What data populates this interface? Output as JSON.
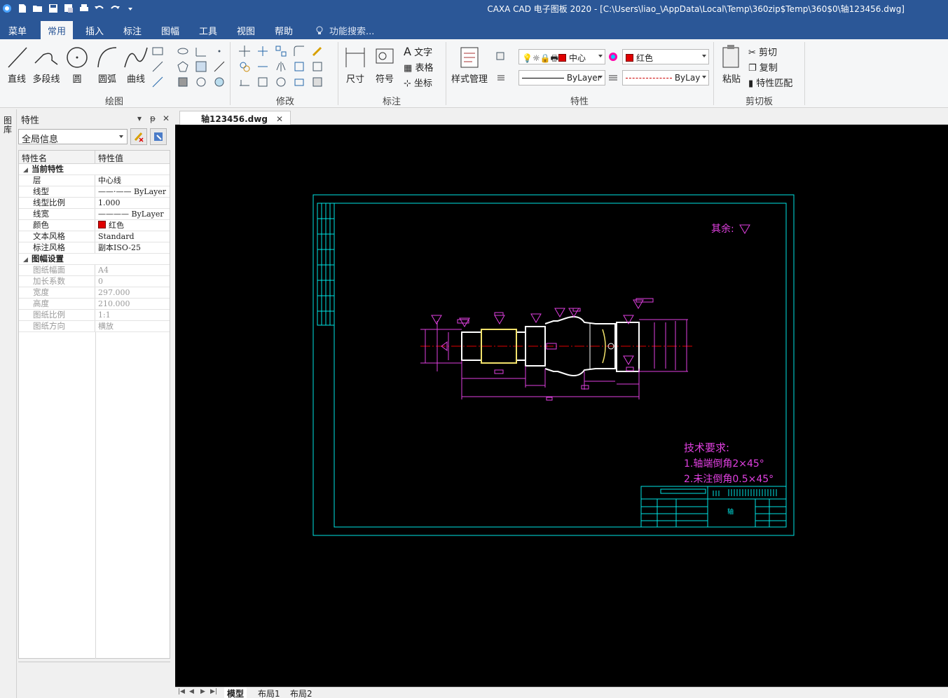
{
  "title": "CAXA CAD 电子图板 2020 - [C:\\Users\\liao_\\AppData\\Local\\Temp\\360zip$Temp\\360$0\\轴123456.dwg]",
  "menu": {
    "tabs": [
      "菜单",
      "常用",
      "插入",
      "标注",
      "图幅",
      "工具",
      "视图",
      "帮助"
    ],
    "active": "常用",
    "search_placeholder": "功能搜索..."
  },
  "ribbon": {
    "draw": {
      "label": "绘图",
      "line": "直线",
      "polyline": "多段线",
      "circle": "圆",
      "arc": "圆弧",
      "curve": "曲线"
    },
    "modify": {
      "label": "修改"
    },
    "annot": {
      "label": "标注",
      "dimension": "尺寸",
      "symbol": "符号",
      "text": "文字",
      "table": "表格",
      "coord": "坐标"
    },
    "style": {
      "label": "样式管理"
    },
    "properties": {
      "label": "特性",
      "layer": "中心",
      "color": "红色",
      "linetype": "ByLayer",
      "linewidth": "ByLay"
    },
    "clipboard": {
      "label": "剪切板",
      "paste": "粘贴",
      "cut": "剪切",
      "copy": "复制",
      "match": "特性匹配"
    }
  },
  "left_strip": {
    "label": "图库"
  },
  "props": {
    "title": "特性",
    "pin": "ᵽ",
    "filter": "全局信息",
    "col_name": "特性名",
    "col_value": "特性值",
    "cat1": "当前特性",
    "rows1": [
      {
        "k": "层",
        "v": "中心线"
      },
      {
        "k": "线型",
        "v": "——·—— ByLayer"
      },
      {
        "k": "线型比例",
        "v": "1.000"
      },
      {
        "k": "线宽",
        "v": "———— ByLayer"
      },
      {
        "k": "颜色",
        "v": "红色"
      },
      {
        "k": "文本风格",
        "v": "Standard"
      },
      {
        "k": "标注风格",
        "v": "副本ISO-25"
      }
    ],
    "cat2": "图幅设置",
    "rows2": [
      {
        "k": "图纸幅面",
        "v": "A4"
      },
      {
        "k": "加长系数",
        "v": "0"
      },
      {
        "k": "宽度",
        "v": "297.000"
      },
      {
        "k": "高度",
        "v": "210.000"
      },
      {
        "k": "图纸比例",
        "v": "1:1"
      },
      {
        "k": "图纸方向",
        "v": "横放"
      }
    ]
  },
  "doc_tab": "轴123456.dwg",
  "drawing": {
    "roughness_note": "其余:",
    "req_title": "技术要求:",
    "req_1": "1.轴端倒角2×45°",
    "req_2": "2.未注倒角0.5×45°",
    "title_block_name": "轴"
  },
  "layout_tabs": [
    "模型",
    "布局1",
    "布局2"
  ],
  "active_layout": "模型",
  "colors": {
    "ribbon_blue": "#2b5797",
    "frame": "#00e5e5",
    "dimension": "#e040e0",
    "geometry": "#ffffff",
    "centerline": "#e00000",
    "highlight": "#f2e26b"
  }
}
